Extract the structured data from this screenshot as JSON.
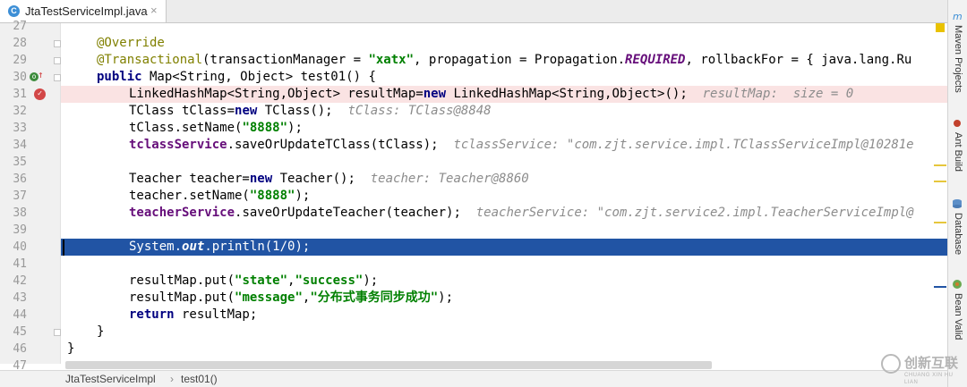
{
  "tab": {
    "label": "JtaTestServiceImpl.java",
    "icon_letter": "C",
    "close": "×"
  },
  "line_numbers": [
    "27",
    "28",
    "29",
    "30",
    "31",
    "32",
    "33",
    "34",
    "35",
    "36",
    "37",
    "38",
    "39",
    "40",
    "41",
    "42",
    "43",
    "44",
    "45",
    "46",
    "47"
  ],
  "code": {
    "l28": "@Override",
    "l29_ann": "@Transactional",
    "l29_a": "(transactionManager = ",
    "l29_str": "\"xatx\"",
    "l29_b": ", propagation = Propagation.",
    "l29_req": "REQUIRED",
    "l29_c": ", rollbackFor = { java.lang.Ru",
    "l30_kw": "public",
    "l30_rest": " Map<String, Object> test01() {",
    "l31_a": "LinkedHashMap<String,Object> resultMap=",
    "l31_kw": "new",
    "l31_b": " LinkedHashMap<String,Object>();",
    "l31_hint": "resultMap:  size = 0",
    "l32_a": "TClass tClass=",
    "l32_kw": "new",
    "l32_b": " TClass();",
    "l32_hint": "tClass: TClass@8848",
    "l33_a": "tClass.setName(",
    "l33_str": "\"8888\"",
    "l33_b": ");",
    "l34_field": "tclassService",
    "l34_a": ".saveOrUpdateTClass(tClass);",
    "l34_hint": "tclassService: \"com.zjt.service.impl.TClassServiceImpl@10281e",
    "l36_a": "Teacher teacher=",
    "l36_kw": "new",
    "l36_b": " Teacher();",
    "l36_hint": "teacher: Teacher@8860",
    "l37_a": "teacher.setName(",
    "l37_str": "\"8888\"",
    "l37_b": ");",
    "l38_field": "teacherService",
    "l38_a": ".saveOrUpdateTeacher(teacher);",
    "l38_hint": "teacherService: \"com.zjt.service2.impl.TeacherServiceImpl@",
    "l40_a": "System.",
    "l40_out": "out",
    "l40_b": ".println(1/0);",
    "l42_a": "resultMap.put(",
    "l42_s1": "\"state\"",
    "l42_b": ",",
    "l42_s2": "\"success\"",
    "l42_c": ");",
    "l43_a": "resultMap.put(",
    "l43_s1": "\"message\"",
    "l43_b": ",",
    "l43_s2": "\"分布式事务同步成功\"",
    "l43_c": ");",
    "l44_kw": "return",
    "l44_rest": " resultMap;",
    "l45": "}",
    "l46": "}"
  },
  "right_tools": [
    "Maven Projects",
    "Ant Build",
    "Database",
    "Bean Valid"
  ],
  "breadcrumb": [
    "JtaTestServiceImpl",
    "test01()"
  ],
  "breadcrumb_sep": "›",
  "watermark": {
    "text": "创新互联",
    "sub": "CHUANG XIN HU LIAN"
  },
  "colors": {
    "selection": "#2154a4",
    "breakpoint_line": "#fae3e3",
    "keyword": "#000080",
    "string": "#008000",
    "annotation": "#808000",
    "field": "#660e7a",
    "hint": "#8c8c8c"
  }
}
